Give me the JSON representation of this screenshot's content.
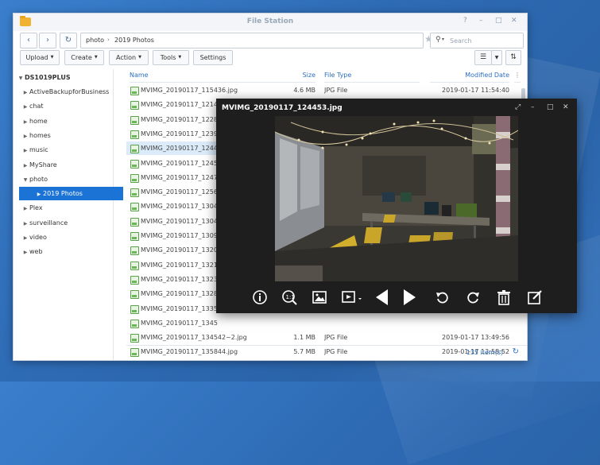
{
  "window": {
    "title": "File Station",
    "controls": [
      "?",
      "–",
      "□",
      "✕"
    ]
  },
  "nav": {
    "back_icon": "‹",
    "forward_icon": "›",
    "refresh_icon": "↻",
    "crumbs": [
      "photo",
      "2019 Photos"
    ],
    "search_placeholder": "Search"
  },
  "toolbar": {
    "upload": "Upload",
    "create": "Create",
    "action": "Action",
    "tools": "Tools",
    "settings": "Settings"
  },
  "sidebar": {
    "root": "DS1019PLUS",
    "items": [
      {
        "label": "ActiveBackupforBusiness",
        "indent": 1,
        "expanded": false
      },
      {
        "label": "chat",
        "indent": 1,
        "expanded": false
      },
      {
        "label": "home",
        "indent": 1,
        "expanded": false
      },
      {
        "label": "homes",
        "indent": 1,
        "expanded": false
      },
      {
        "label": "music",
        "indent": 1,
        "expanded": false
      },
      {
        "label": "MyShare",
        "indent": 1,
        "expanded": false
      },
      {
        "label": "photo",
        "indent": 1,
        "expanded": true
      },
      {
        "label": "2019 Photos",
        "indent": 2,
        "expanded": false,
        "selected": true
      },
      {
        "label": "Plex",
        "indent": 1,
        "expanded": false
      },
      {
        "label": "surveillance",
        "indent": 1,
        "expanded": false
      },
      {
        "label": "video",
        "indent": 1,
        "expanded": false
      },
      {
        "label": "web",
        "indent": 1,
        "expanded": false
      }
    ]
  },
  "list": {
    "headers": {
      "name": "Name",
      "size": "Size",
      "type": "File Type",
      "modified": "Modified Date"
    },
    "rows": [
      {
        "name": "MVIMG_20190117_115436.jpg",
        "size": "4.6 MB",
        "type": "JPG File",
        "modified": "2019-01-17 11:54:40"
      },
      {
        "name": "MVIMG_20190117_1214",
        "size": "",
        "type": "",
        "modified": ""
      },
      {
        "name": "MVIMG_20190117_1228",
        "size": "",
        "type": "",
        "modified": ""
      },
      {
        "name": "MVIMG_20190117_1239",
        "size": "",
        "type": "",
        "modified": ""
      },
      {
        "name": "MVIMG_20190117_1244",
        "size": "",
        "type": "",
        "modified": "",
        "selected": true
      },
      {
        "name": "MVIMG_20190117_1245",
        "size": "",
        "type": "",
        "modified": ""
      },
      {
        "name": "MVIMG_20190117_1247",
        "size": "",
        "type": "",
        "modified": ""
      },
      {
        "name": "MVIMG_20190117_1256",
        "size": "",
        "type": "",
        "modified": ""
      },
      {
        "name": "MVIMG_20190117_1304",
        "size": "",
        "type": "",
        "modified": ""
      },
      {
        "name": "MVIMG_20190117_1304",
        "size": "",
        "type": "",
        "modified": ""
      },
      {
        "name": "MVIMG_20190117_1309",
        "size": "",
        "type": "",
        "modified": ""
      },
      {
        "name": "MVIMG_20190117_1320",
        "size": "",
        "type": "",
        "modified": ""
      },
      {
        "name": "MVIMG_20190117_1321",
        "size": "",
        "type": "",
        "modified": ""
      },
      {
        "name": "MVIMG_20190117_1323",
        "size": "",
        "type": "",
        "modified": ""
      },
      {
        "name": "MVIMG_20190117_1328",
        "size": "",
        "type": "",
        "modified": ""
      },
      {
        "name": "MVIMG_20190117_1335",
        "size": "",
        "type": "",
        "modified": ""
      },
      {
        "name": "MVIMG_20190117_1345",
        "size": "",
        "type": "",
        "modified": ""
      },
      {
        "name": "MVIMG_20190117_134542~2.jpg",
        "size": "1.1 MB",
        "type": "JPG File",
        "modified": "2019-01-17 13:49:56"
      },
      {
        "name": "MVIMG_20190117_135844.jpg",
        "size": "5.7 MB",
        "type": "JPG File",
        "modified": "2019-01-17 13:58:52"
      }
    ],
    "count": "135 item(s)"
  },
  "viewer": {
    "title": "MVIMG_20190117_124453.jpg",
    "controls": [
      "⤢",
      "–",
      "□",
      "✕"
    ]
  },
  "colors": {
    "accent": "#1b73d6",
    "desktop": "#2f6fb8",
    "viewer_bg": "#1e1e1e"
  }
}
